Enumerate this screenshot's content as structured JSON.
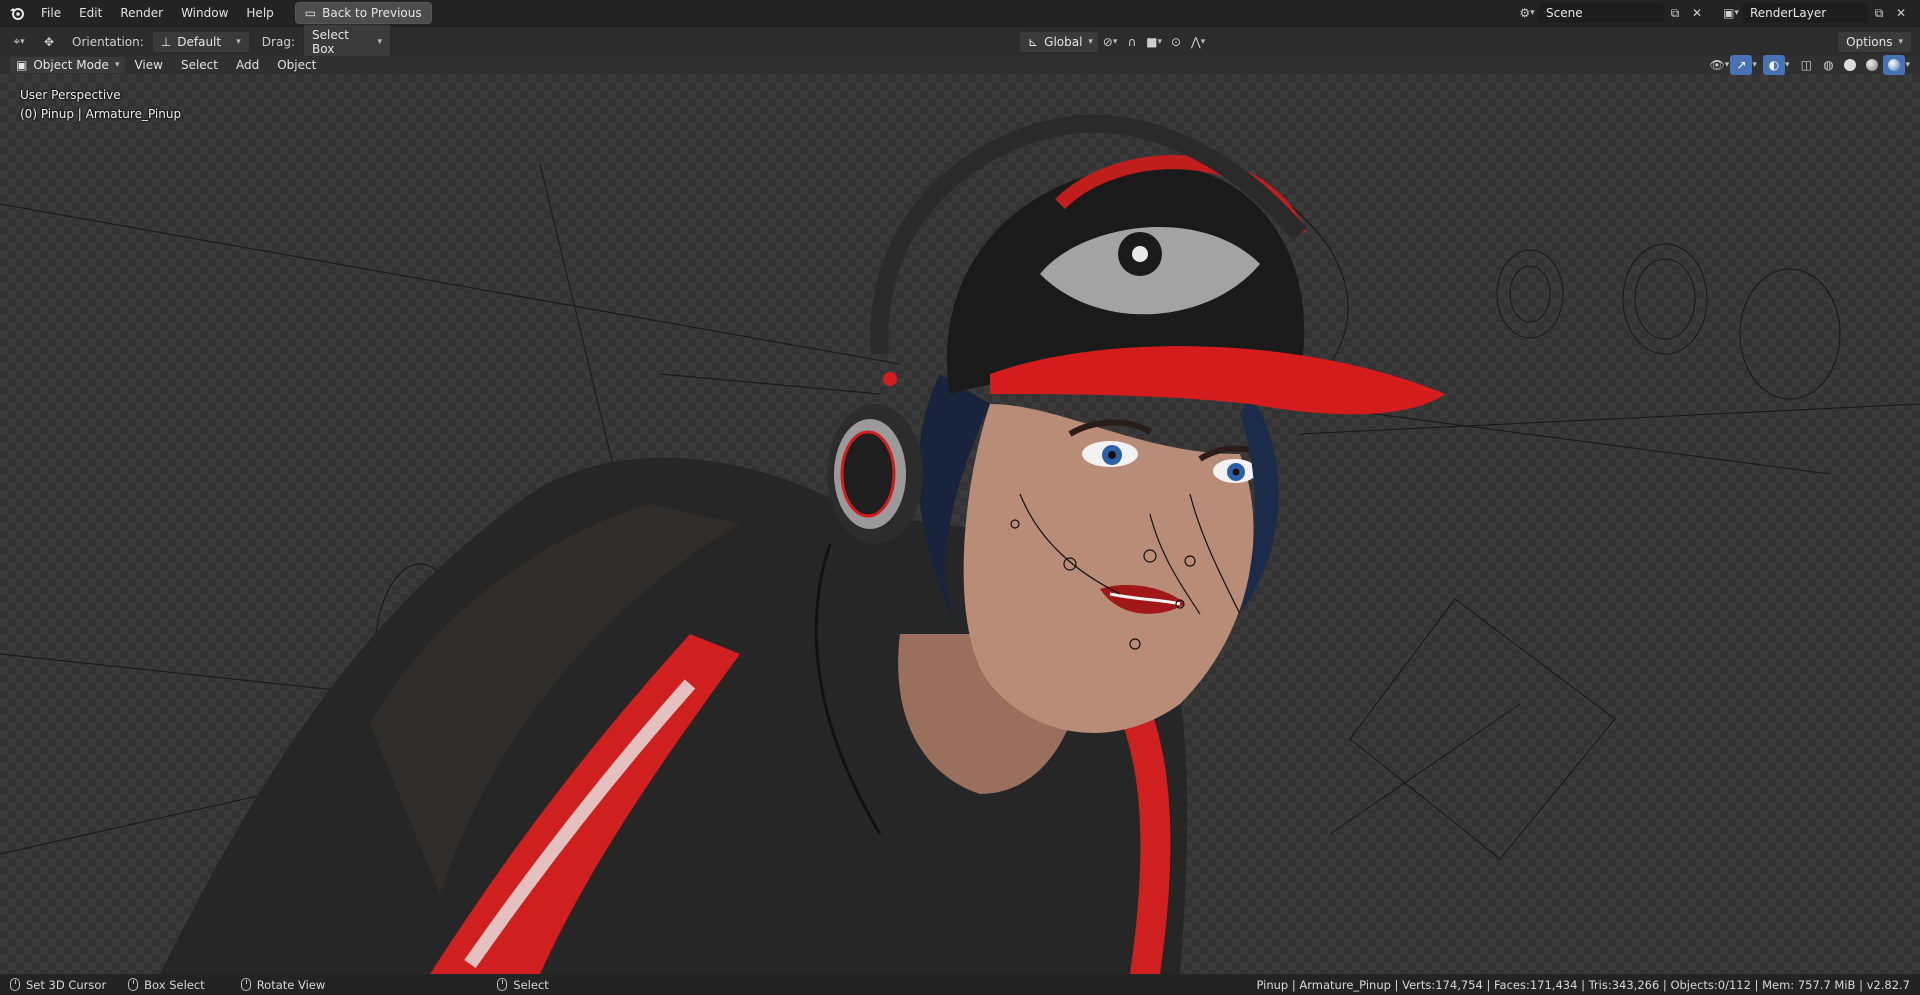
{
  "topbar": {
    "menus": [
      "File",
      "Edit",
      "Render",
      "Window",
      "Help"
    ],
    "back_button": "Back to Previous",
    "scene_name": "Scene",
    "render_layer": "RenderLayer"
  },
  "toolbar": {
    "orientation_label": "Orientation:",
    "orientation_value": "Default",
    "drag_label": "Drag:",
    "drag_value": "Select Box",
    "transform_space": "Global",
    "options_label": "Options"
  },
  "viewport_header": {
    "mode": "Object Mode",
    "menus": [
      "View",
      "Select",
      "Add",
      "Object"
    ]
  },
  "viewport": {
    "perspective_label": "User Perspective",
    "object_label": "(0) Pinup | Armature_Pinup"
  },
  "statusbar": {
    "hints": [
      "Set 3D Cursor",
      "Box Select",
      "Rotate View",
      "Select"
    ],
    "stats": "Pinup | Armature_Pinup | Verts:174,754 | Faces:171,434 | Tris:343,266 | Objects:0/112 | Mem: 757.7 MiB | v2.82.7"
  },
  "colors": {
    "accent": "#4772b3",
    "cap_red": "#d41c1c",
    "jacket": "#262626"
  }
}
